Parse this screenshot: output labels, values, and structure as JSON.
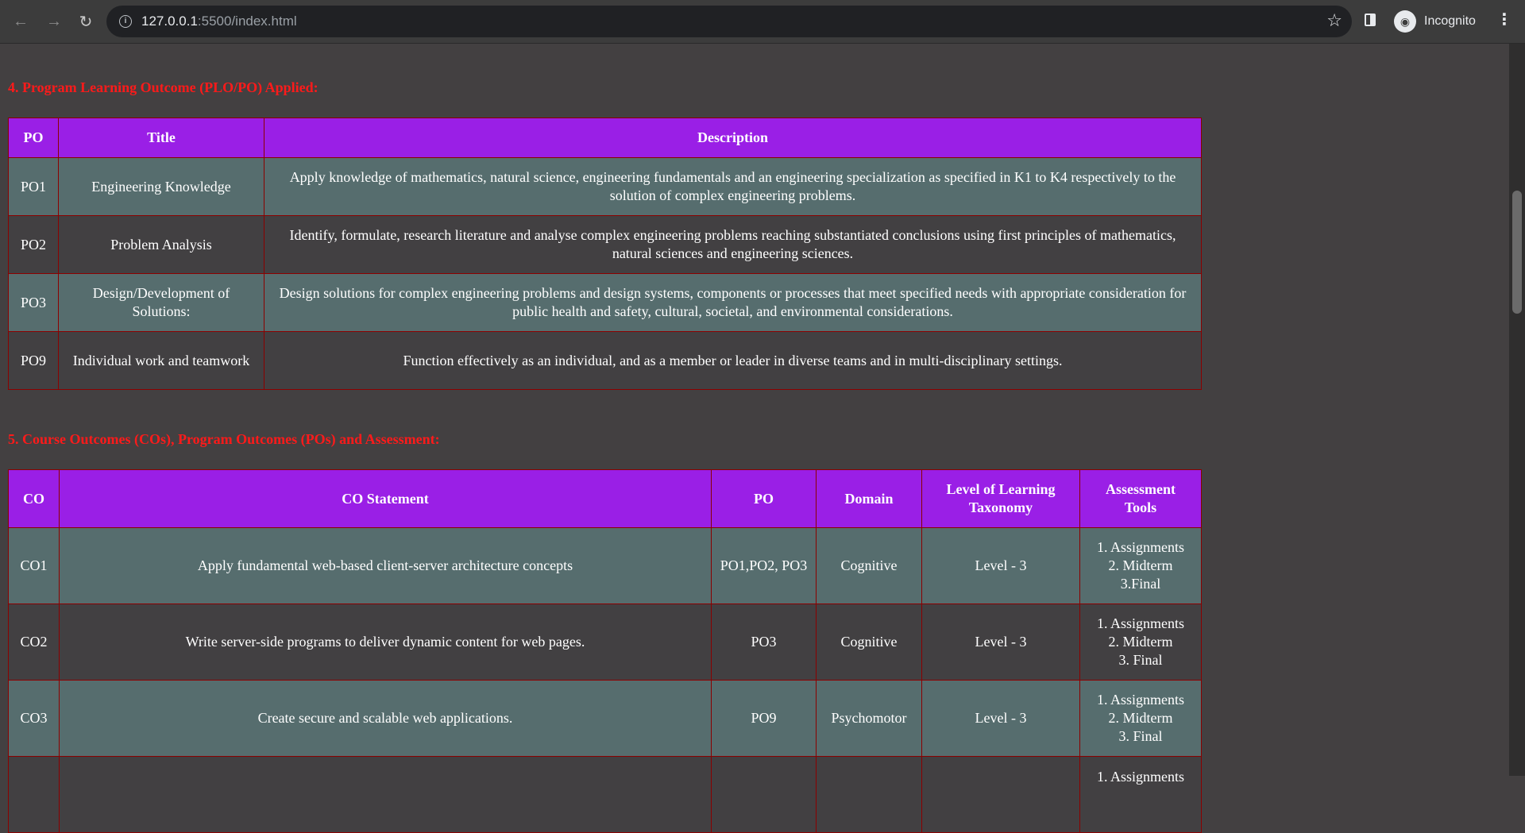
{
  "browser": {
    "url_host": "127.0.0.1",
    "url_path": ":5500/index.html",
    "profile_label": "Incognito"
  },
  "po_section": {
    "heading": "4. Program Learning Outcome (PLO/PO) Applied:",
    "headers": [
      "PO",
      "Title",
      "Description"
    ],
    "rows": [
      {
        "po": "PO1",
        "title": "Engineering Knowledge",
        "description": "Apply knowledge of mathematics, natural science, engineering fundamentals and an engineering specialization as specified in K1 to K4 respectively to the solution of complex engineering problems."
      },
      {
        "po": "PO2",
        "title": "Problem Analysis",
        "description": "Identify, formulate, research literature and analyse complex engineering problems reaching substantiated conclusions using first principles of mathematics, natural sciences and engineering sciences."
      },
      {
        "po": "PO3",
        "title": "Design/Development of Solutions:",
        "description": "Design solutions for complex engineering problems and design systems, components or processes that meet specified needs with appropriate consideration for public health and safety, cultural, societal, and environmental considerations."
      },
      {
        "po": "PO9",
        "title": "Individual work and teamwork",
        "description": "Function effectively as an individual, and as a member or leader in diverse teams and in multi-disciplinary settings."
      }
    ]
  },
  "co_section": {
    "heading": "5. Course Outcomes (COs), Program Outcomes (POs) and Assessment:",
    "headers": [
      "CO",
      "CO Statement",
      "PO",
      "Domain",
      "Level of Learning Taxonomy",
      "Assessment Tools"
    ],
    "rows": [
      {
        "co": "CO1",
        "statement": "Apply fundamental web-based client-server architecture concepts",
        "po": "PO1,PO2, PO3",
        "domain": "Cognitive",
        "level": "Level - 3",
        "tools": [
          "1. Assignments",
          "2. Midterm",
          "3.Final"
        ]
      },
      {
        "co": "CO2",
        "statement": "Write server-side programs to deliver dynamic content for web pages.",
        "po": "PO3",
        "domain": "Cognitive",
        "level": "Level - 3",
        "tools": [
          "1. Assignments",
          "2. Midterm",
          "3. Final"
        ]
      },
      {
        "co": "CO3",
        "statement": "Create secure and scalable web applications.",
        "po": "PO9",
        "domain": "Psychomotor",
        "level": "Level - 3",
        "tools": [
          "1. Assignments",
          "2. Midterm",
          "3. Final"
        ]
      },
      {
        "co": "",
        "statement": "",
        "po": "",
        "domain": "",
        "level": "",
        "tools": [
          "1. Assignments"
        ]
      }
    ]
  }
}
